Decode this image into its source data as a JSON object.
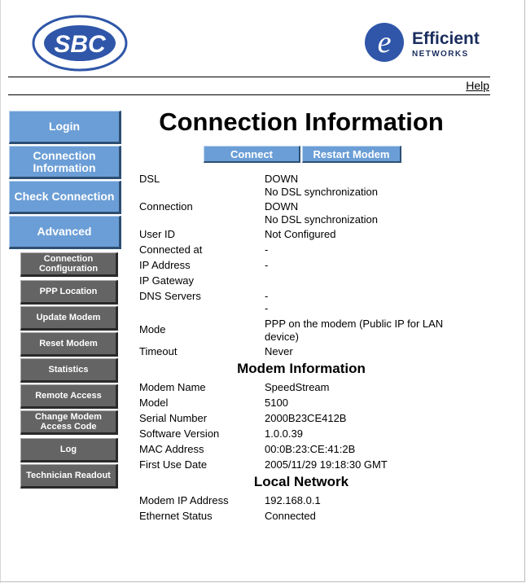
{
  "header": {
    "sbc_logo_text": "SBC",
    "efficient_name": "Efficient",
    "efficient_sub": "NETWORKS",
    "help_label": "Help"
  },
  "nav": {
    "main": [
      "Login",
      "Connection Information",
      "Check Connection",
      "Advanced"
    ],
    "sub": [
      "Connection Configuration",
      "PPP Location",
      "Update Modem",
      "Reset Modem",
      "Statistics",
      "Remote Access",
      "Change Modem Access Code",
      "Log",
      "Technician Readout"
    ]
  },
  "page_title": "Connection Information",
  "buttons": {
    "connect": "Connect",
    "restart": "Restart Modem"
  },
  "connection": {
    "dsl_label": "DSL",
    "dsl_value": "DOWN",
    "dsl_detail": "No DSL synchronization",
    "conn_label": "Connection",
    "conn_value": "DOWN",
    "conn_detail": "No DSL synchronization",
    "userid_label": "User ID",
    "userid_value": "Not Configured",
    "connected_at_label": "Connected at",
    "connected_at_value": "-",
    "ip_label": "IP Address",
    "ip_value": "-",
    "gateway_label": "IP Gateway",
    "dns_label": "DNS Servers",
    "dns_value_1": "-",
    "dns_value_2": "-",
    "mode_label": "Mode",
    "mode_value": "PPP on the modem (Public IP for LAN device)",
    "timeout_label": "Timeout",
    "timeout_value": "Never"
  },
  "modem": {
    "title": "Modem Information",
    "name_label": "Modem Name",
    "name_value": "SpeedStream",
    "model_label": "Model",
    "model_value": "5100",
    "serial_label": "Serial Number",
    "serial_value": "2000B23CE412B",
    "sw_label": "Software Version",
    "sw_value": "1.0.0.39",
    "mac_label": "MAC Address",
    "mac_value": "00:0B:23:CE:41:2B",
    "first_use_label": "First Use Date",
    "first_use_value": "2005/11/29 19:18:30 GMT"
  },
  "local": {
    "title": "Local Network",
    "modem_ip_label": "Modem IP Address",
    "modem_ip_value": "192.168.0.1",
    "eth_label": "Ethernet Status",
    "eth_value": "Connected"
  },
  "colors": {
    "nav_blue": "#6b9ed6",
    "nav_gray": "#646464",
    "logo_blue": "#2f56a8"
  }
}
